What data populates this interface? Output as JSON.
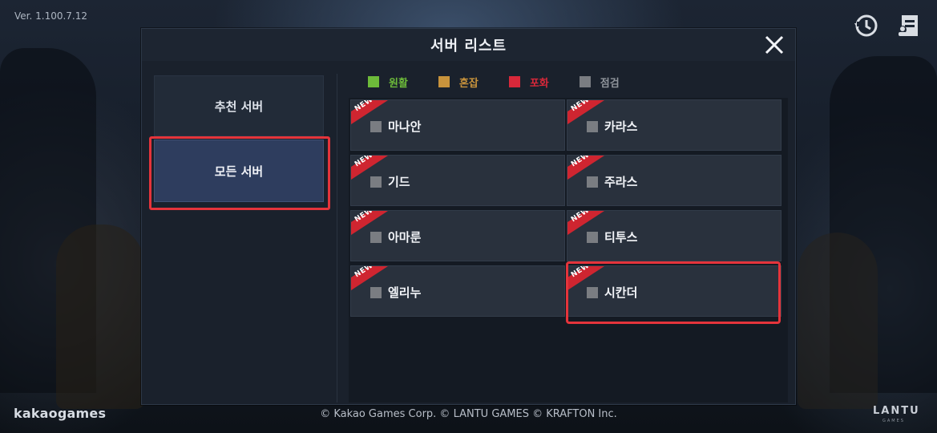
{
  "version": "Ver. 1.100.7.12",
  "top_icons": [
    "restore-icon",
    "notice-icon"
  ],
  "modal": {
    "title": "서버 리스트",
    "close_icon": "close-icon"
  },
  "tabs": [
    {
      "label": "추천 서버",
      "selected": false
    },
    {
      "label": "모든 서버",
      "selected": true
    }
  ],
  "legend": [
    {
      "label": "원활",
      "color": "#6dbb3a"
    },
    {
      "label": "혼잡",
      "color": "#c8933c"
    },
    {
      "label": "포화",
      "color": "#d8283a"
    },
    {
      "label": "점검",
      "color": "#7a7d82"
    }
  ],
  "new_badge": "NEW",
  "servers": [
    {
      "name": "마나안",
      "status": "점검",
      "new": true
    },
    {
      "name": "카라스",
      "status": "점검",
      "new": true
    },
    {
      "name": "기드",
      "status": "점검",
      "new": true
    },
    {
      "name": "주라스",
      "status": "점검",
      "new": true
    },
    {
      "name": "아마룬",
      "status": "점검",
      "new": true
    },
    {
      "name": "티투스",
      "status": "점검",
      "new": true
    },
    {
      "name": "엘리누",
      "status": "점검",
      "new": true
    },
    {
      "name": "시칸더",
      "status": "점검",
      "new": true
    }
  ],
  "footer": {
    "brand": "kakaogames",
    "copyright": "© Kakao Games Corp. © LANTU GAMES © KRAFTON Inc.",
    "logo": "LANTU",
    "logo_sub": "GAMES"
  },
  "colors": {
    "highlight": "#e5343b",
    "ribbon": "#cf2530"
  }
}
